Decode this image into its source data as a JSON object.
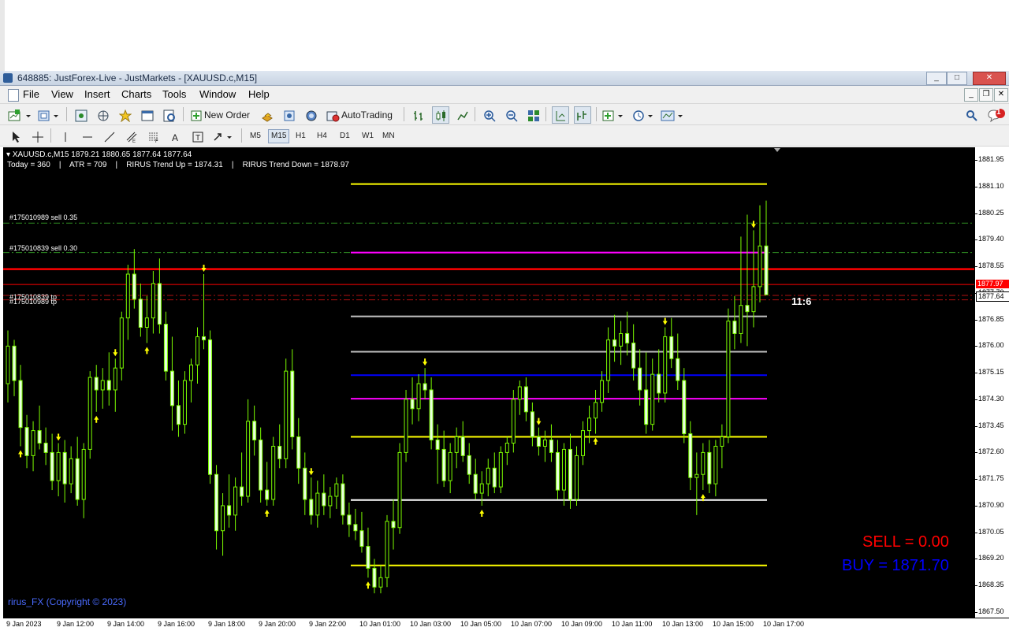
{
  "window": {
    "title": "648885: JustForex-Live - JustMarkets - [XAUUSD.c,M15]",
    "controls": [
      "_",
      "□",
      "✕"
    ]
  },
  "menu": [
    "File",
    "View",
    "Insert",
    "Charts",
    "Tools",
    "Window",
    "Help"
  ],
  "toolbar": {
    "new_order": "New Order",
    "auto_trading": "AutoTrading",
    "notifications_count": "1"
  },
  "timeframes": [
    "M5",
    "M15",
    "H1",
    "H4",
    "D1",
    "W1",
    "MN"
  ],
  "active_timeframe": "M15",
  "chart": {
    "header": "XAUUSD.c,M15  1879.21 1880.65 1877.64 1877.64",
    "indicator_line": "Today = 360    |    ATR = 709    |    RIRUS Trend Up = 1874.31    |    RIRUS Trend Down = 1878.97",
    "order_labels": [
      "#175010989 sell 0.35",
      "#175010839 sell 0.30",
      "#175010839 tp",
      "#175010989 tp"
    ],
    "timer": "11:6",
    "sell_text": "SELL = 0.00",
    "buy_text": "BUY = 1871.70",
    "copyright": "rirus_FX (Copyright © 2023)",
    "price_labels": [
      "1881.95",
      "1881.10",
      "1880.25",
      "1879.40",
      "1878.55",
      "1877.70",
      "1876.85",
      "1876.00",
      "1875.15",
      "1874.30",
      "1873.45",
      "1872.60",
      "1871.75",
      "1870.90",
      "1870.05",
      "1869.20",
      "1868.35",
      "1867.50"
    ],
    "bid_flag": "1877.64",
    "ask_flag": "1877.97",
    "time_labels": [
      "9 Jan 2023",
      "9 Jan 12:00",
      "9 Jan 14:00",
      "9 Jan 16:00",
      "9 Jan 18:00",
      "9 Jan 20:00",
      "9 Jan 22:00",
      "10 Jan 01:00",
      "10 Jan 03:00",
      "10 Jan 05:00",
      "10 Jan 07:00",
      "10 Jan 09:00",
      "10 Jan 11:00",
      "10 Jan 13:00",
      "10 Jan 15:00",
      "10 Jan 17:00"
    ],
    "colors": {
      "background": "#000000",
      "candle": "#7CFC00",
      "arrow": "#FFFF00",
      "sell_line": "#FF0000",
      "order_line": "#2E8B22",
      "level_yellow": "#FFFF00",
      "level_magenta": "#FF00FF",
      "level_blue": "#0000FF",
      "level_white": "#FFFFFF",
      "level_grey": "#C0C0C0",
      "sell_text": "#FF0000",
      "buy_text": "#0000FF",
      "copyright": "#4A6BFF"
    }
  }
}
